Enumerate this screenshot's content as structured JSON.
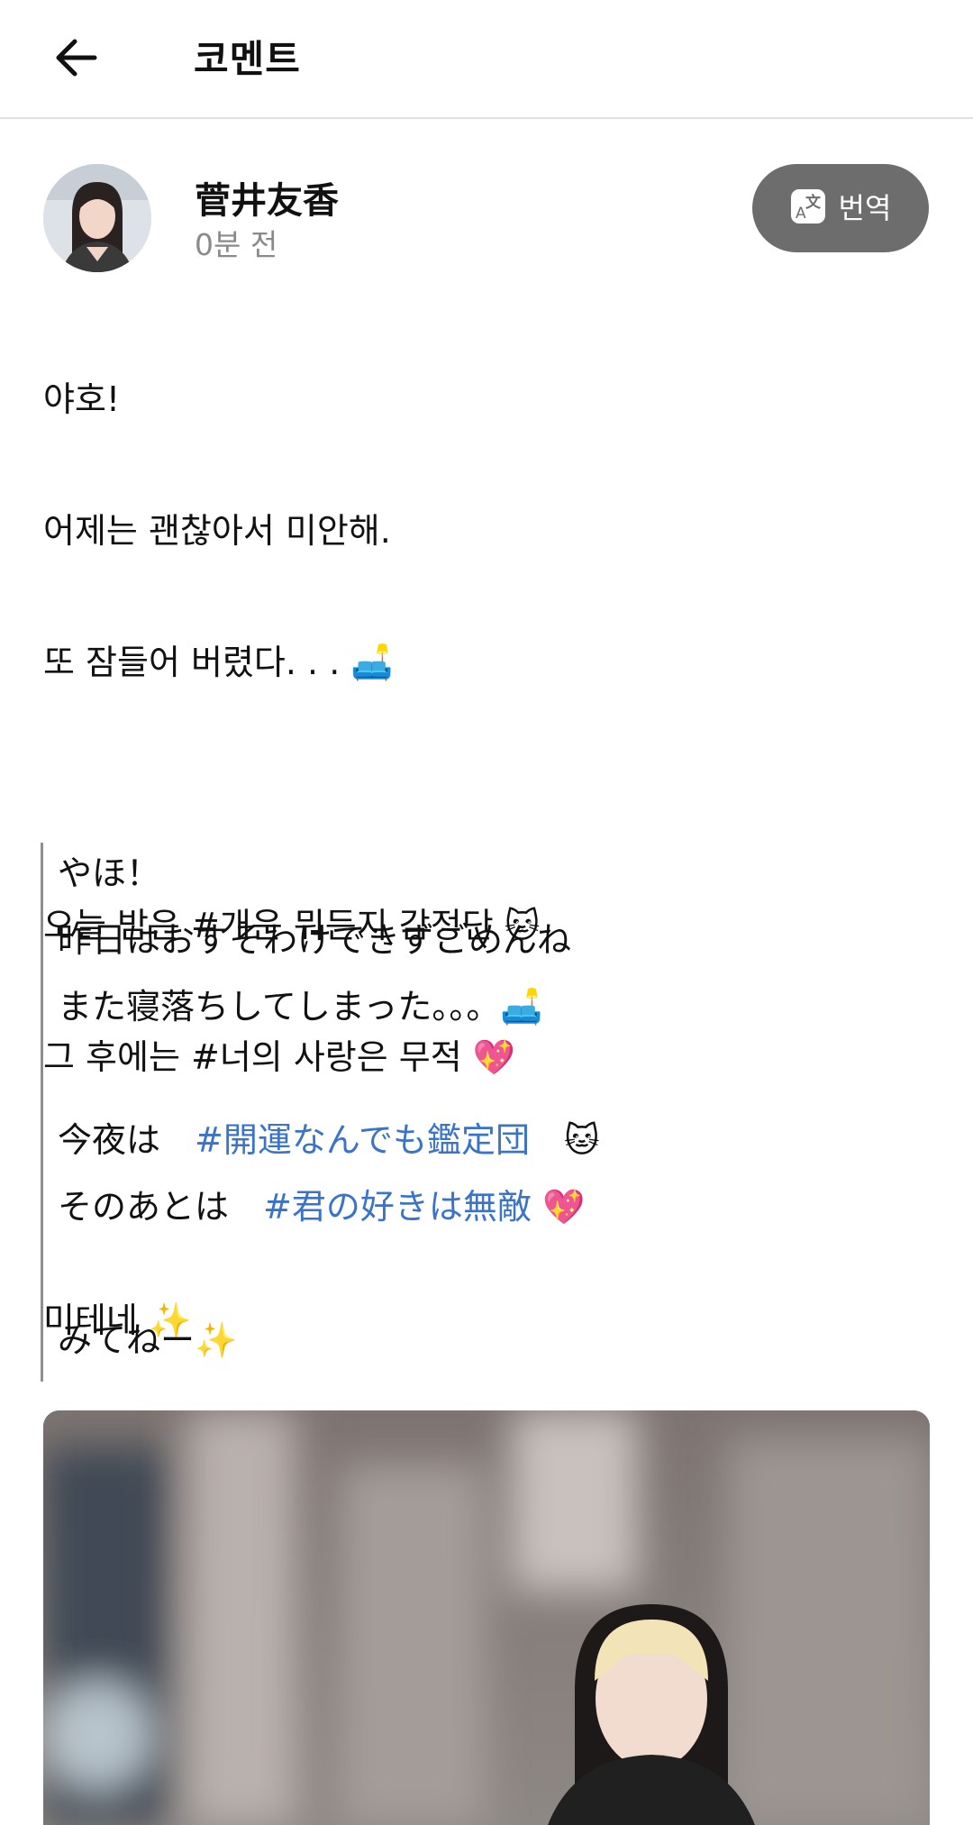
{
  "header": {
    "title": "코멘트"
  },
  "post": {
    "author": "菅井友香",
    "time": "0분 전",
    "translate_label": "번역",
    "korean_lines": [
      "야호!",
      "어제는 괜찮아서 미안해.",
      "또 잠들어 버렸다. . . 🛋️",
      "",
      "오늘 밤은 #개운 뭐든지 감정단 🐱",
      "그 후에는 #너의 사랑은 무적 💖",
      "",
      "미테네 ✨"
    ],
    "original": {
      "line1": "やほ！",
      "line2": "昨日はおすそわけできずごめんね",
      "line3": "また寝落ちしてしまった。。。🛋️",
      "line4_prefix": "今夜は　",
      "line4_hashtag": "#開運なんでも鑑定団",
      "line4_suffix": "　🐱",
      "line5_prefix": "そのあとは　",
      "line5_hashtag": "#君の好きは無敵",
      "line5_suffix": " 💖",
      "line6": "みてねー✨"
    }
  },
  "icons": {
    "back": "arrow-left-icon",
    "translate": "translate-icon"
  }
}
